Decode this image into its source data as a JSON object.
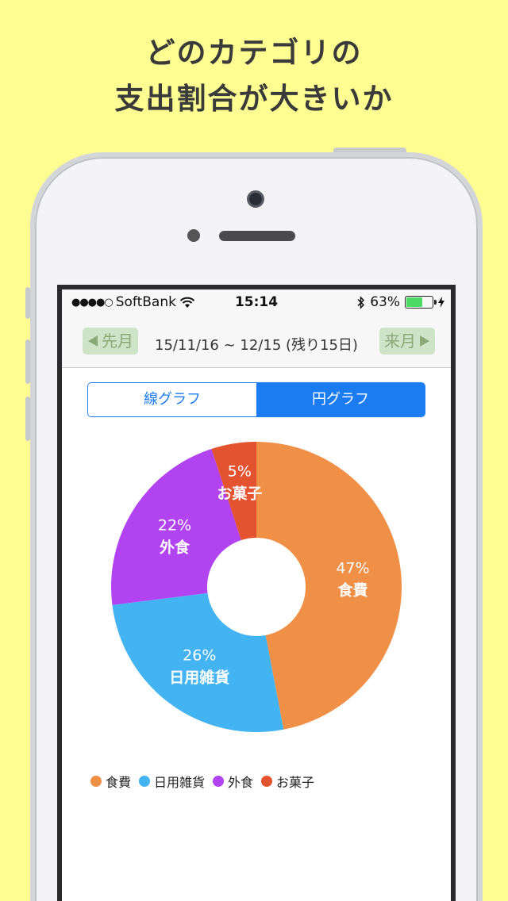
{
  "headline": {
    "line1": "どのカテゴリの",
    "line2": "支出割合が大きいか"
  },
  "statusbar": {
    "signal": "●●●●○",
    "carrier": "SoftBank",
    "time": "15:14",
    "battery_text": "63%",
    "battery_level": 0.63
  },
  "navbar": {
    "prev_label": "先月",
    "next_label": "来月",
    "range": "15/11/16 ~ 12/15 (残り15日)"
  },
  "tabs": [
    {
      "label": "線グラフ",
      "selected": false
    },
    {
      "label": "円グラフ",
      "selected": true
    }
  ],
  "colors": {
    "background": "#fdfd92",
    "accent": "#1b7cf2",
    "nav_button": "#cfe3c9"
  },
  "chart_data": {
    "type": "pie",
    "donut": true,
    "categories": [
      "食費",
      "日用雑貨",
      "外食",
      "お菓子"
    ],
    "values": [
      47,
      26,
      22,
      5
    ],
    "labels": [
      "47%",
      "26%",
      "22%",
      "5%"
    ],
    "colors": [
      "#f08f46",
      "#44b3f2",
      "#b144f0",
      "#e4532f"
    ],
    "legend_placement": "bottom-left"
  },
  "icons": {
    "prev": "triangle-left-icon",
    "next": "triangle-right-icon",
    "wifi": "wifi-icon",
    "bluetooth": "bluetooth-icon",
    "charging": "bolt-icon"
  }
}
